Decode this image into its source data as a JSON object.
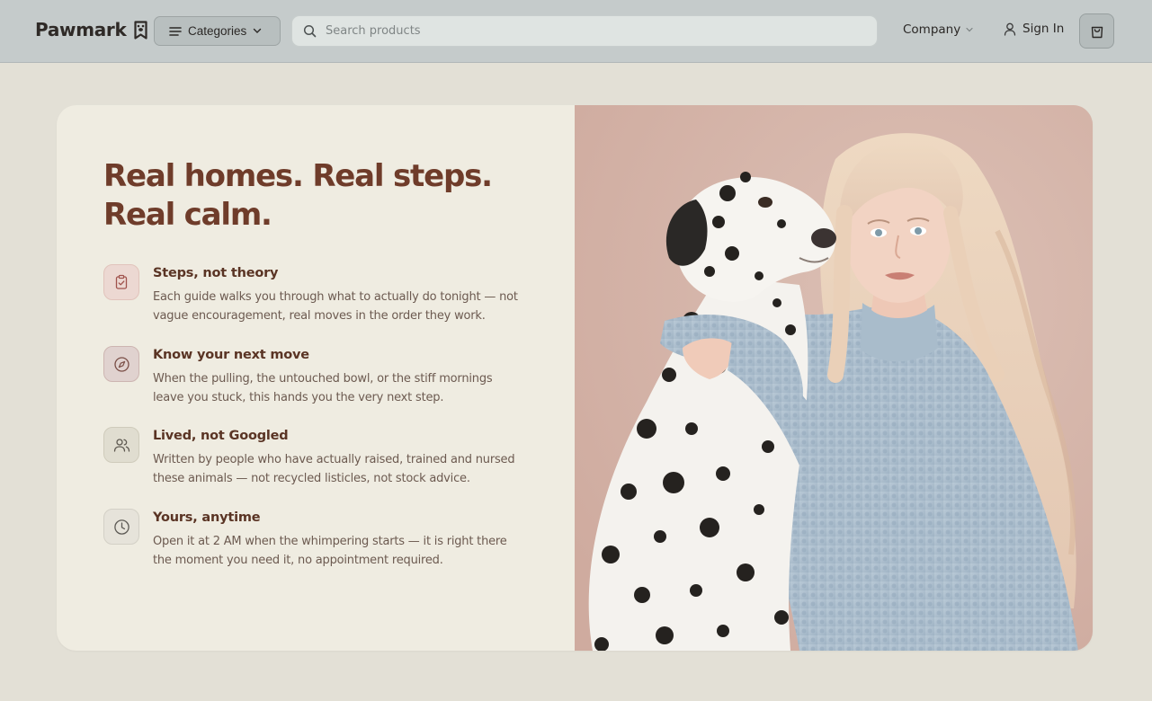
{
  "header": {
    "brand": "Pawmark",
    "categories_label": "Categories",
    "search_placeholder": "Search products",
    "company_label": "Company",
    "signin_label": "Sign In"
  },
  "hero": {
    "headline": "Real homes. Real steps. Real calm.",
    "features": [
      {
        "icon": "clipboard-check-icon",
        "title": "Steps, not theory",
        "description": "Each guide walks you through what to actually do tonight — not vague encouragement, real moves in the order they work."
      },
      {
        "icon": "compass-icon",
        "title": "Know your next move",
        "description": "When the pulling, the untouched bowl, or the stiff mornings leave you stuck, this hands you the very next step."
      },
      {
        "icon": "users-icon",
        "title": "Lived, not Googled",
        "description": "Written by people who have actually raised, trained and nursed these animals — not recycled listicles, not stock advice."
      },
      {
        "icon": "clock-icon",
        "title": "Yours, anytime",
        "description": "Open it at 2 AM when the whimpering starts — it is right there the moment you need it, no appointment required."
      }
    ],
    "photo_subject": "woman-hugging-dalmatian-photo"
  },
  "colors": {
    "header_bg": "#c5cbcb",
    "page_bg": "#e3e0d6",
    "card_bg": "#efece1",
    "headline": "#6f3c2a",
    "photo_bg": "#d7b9ae"
  }
}
